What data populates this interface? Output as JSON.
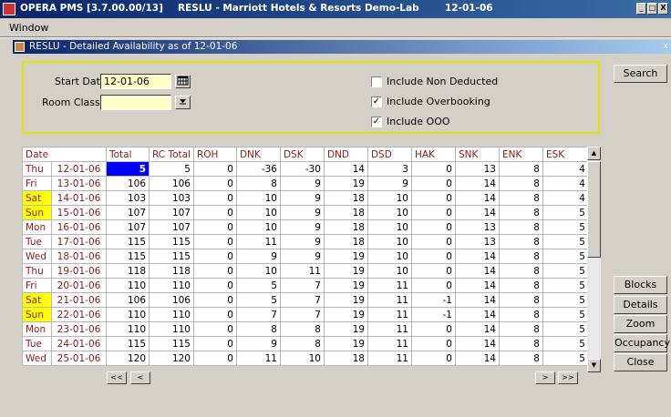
{
  "window": {
    "app_name": "OPERA PMS [3.7.00.00/13]",
    "property": "RESLU - Marriott Hotels & Resorts Demo-Lab",
    "business_date": "12-01-06",
    "controls": [
      "_",
      "□",
      "X"
    ]
  },
  "menu": {
    "items": [
      "Window"
    ]
  },
  "subwindow": {
    "title": "RESLU - Detailed Availability as of 12-01-06",
    "close": "x"
  },
  "criteria": {
    "start_date_label": "Start Date",
    "start_date_value": "12-01-06",
    "room_class_label": "Room Class",
    "room_class_value": "",
    "checkboxes": [
      {
        "label": "Include Non Deducted",
        "checked": false
      },
      {
        "label": "Include Overbooking",
        "checked": true
      },
      {
        "label": "Include OOO",
        "checked": true
      }
    ]
  },
  "buttons": {
    "search": "Search",
    "blocks": "Blocks",
    "details": "Details",
    "zoom": "Zoom",
    "occupancy": "Occupancy",
    "close": "Close",
    "first": "<<",
    "prev": "<",
    "next": ">",
    "last": ">>"
  },
  "grid": {
    "headers": [
      "Date",
      "Total",
      "RC Total",
      "ROH",
      "DNK",
      "DSK",
      "DND",
      "DSD",
      "HAK",
      "SNK",
      "ENK",
      "ESK"
    ],
    "rows": [
      {
        "day": "Thu",
        "date": "12-01-06",
        "weekend": false,
        "values": [
          "5",
          "5",
          "0",
          "-36",
          "-30",
          "14",
          "3",
          "0",
          "13",
          "8",
          "4"
        ]
      },
      {
        "day": "Fri",
        "date": "13-01-06",
        "weekend": false,
        "values": [
          "106",
          "106",
          "0",
          "8",
          "9",
          "19",
          "9",
          "0",
          "14",
          "8",
          "4"
        ]
      },
      {
        "day": "Sat",
        "date": "14-01-06",
        "weekend": true,
        "values": [
          "103",
          "103",
          "0",
          "10",
          "9",
          "18",
          "10",
          "0",
          "14",
          "8",
          "4"
        ]
      },
      {
        "day": "Sun",
        "date": "15-01-06",
        "weekend": true,
        "values": [
          "107",
          "107",
          "0",
          "10",
          "9",
          "18",
          "10",
          "0",
          "14",
          "8",
          "5"
        ]
      },
      {
        "day": "Mon",
        "date": "16-01-06",
        "weekend": false,
        "values": [
          "107",
          "107",
          "0",
          "10",
          "9",
          "18",
          "10",
          "0",
          "13",
          "8",
          "5"
        ]
      },
      {
        "day": "Tue",
        "date": "17-01-06",
        "weekend": false,
        "values": [
          "115",
          "115",
          "0",
          "11",
          "9",
          "18",
          "10",
          "0",
          "13",
          "8",
          "5"
        ]
      },
      {
        "day": "Wed",
        "date": "18-01-06",
        "weekend": false,
        "values": [
          "115",
          "115",
          "0",
          "9",
          "9",
          "19",
          "10",
          "0",
          "14",
          "8",
          "5"
        ]
      },
      {
        "day": "Thu",
        "date": "19-01-06",
        "weekend": false,
        "values": [
          "118",
          "118",
          "0",
          "10",
          "11",
          "19",
          "10",
          "0",
          "14",
          "8",
          "5"
        ]
      },
      {
        "day": "Fri",
        "date": "20-01-06",
        "weekend": false,
        "values": [
          "110",
          "110",
          "0",
          "5",
          "7",
          "19",
          "11",
          "0",
          "14",
          "8",
          "5"
        ]
      },
      {
        "day": "Sat",
        "date": "21-01-06",
        "weekend": true,
        "values": [
          "106",
          "106",
          "0",
          "5",
          "7",
          "19",
          "11",
          "-1",
          "14",
          "8",
          "5"
        ]
      },
      {
        "day": "Sun",
        "date": "22-01-06",
        "weekend": true,
        "values": [
          "110",
          "110",
          "0",
          "7",
          "7",
          "19",
          "11",
          "-1",
          "14",
          "8",
          "5"
        ]
      },
      {
        "day": "Mon",
        "date": "23-01-06",
        "weekend": false,
        "values": [
          "110",
          "110",
          "0",
          "8",
          "8",
          "19",
          "11",
          "0",
          "14",
          "8",
          "5"
        ]
      },
      {
        "day": "Tue",
        "date": "24-01-06",
        "weekend": false,
        "values": [
          "115",
          "115",
          "0",
          "9",
          "8",
          "19",
          "11",
          "0",
          "14",
          "8",
          "5"
        ]
      },
      {
        "day": "Wed",
        "date": "25-01-06",
        "weekend": false,
        "values": [
          "120",
          "120",
          "0",
          "11",
          "10",
          "18",
          "11",
          "0",
          "14",
          "8",
          "5"
        ]
      }
    ]
  },
  "colors": {
    "title_bar": "#0a246a",
    "criteria_border": "#e8e200",
    "weekend": "#ffff00",
    "selected_cell": "#0000ff",
    "label_text": "#8b1a1a"
  },
  "icons": {
    "calendar": "calendar-icon",
    "dropdown": "dropdown-arrow-icon"
  }
}
